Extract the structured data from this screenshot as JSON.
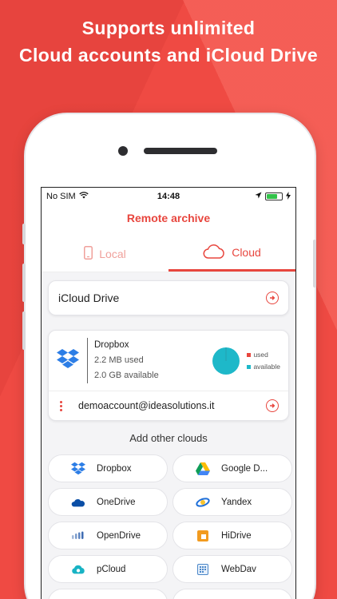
{
  "promo": {
    "line1": "Supports unlimited",
    "line2": "Cloud accounts and iCloud Drive"
  },
  "status_bar": {
    "carrier": "No SIM",
    "time": "14:48",
    "battery_color": "#33c34a"
  },
  "nav": {
    "title": "Remote archive"
  },
  "tabs": [
    {
      "label": "Local",
      "icon": "phone-icon",
      "active": false
    },
    {
      "label": "Cloud",
      "icon": "cloud-icon",
      "active": true
    }
  ],
  "icloud": {
    "label": "iCloud Drive"
  },
  "dropbox": {
    "name": "Dropbox",
    "used": "2.2 MB used",
    "available": "2.0 GB available",
    "used_fraction": 0.001,
    "legend_used": "used",
    "legend_available": "available",
    "used_color": "#e8463e",
    "available_color": "#1eb8c9",
    "account": "demoaccount@ideasolutions.it"
  },
  "add_other": {
    "title": "Add other clouds",
    "services": [
      {
        "label": "Dropbox",
        "icon": "dropbox-icon"
      },
      {
        "label": "Google D...",
        "icon": "google-drive-icon"
      },
      {
        "label": "OneDrive",
        "icon": "onedrive-icon"
      },
      {
        "label": "Yandex",
        "icon": "yandex-icon"
      },
      {
        "label": "OpenDrive",
        "icon": "opendrive-icon"
      },
      {
        "label": "HiDrive",
        "icon": "hidrive-icon"
      },
      {
        "label": "pCloud",
        "icon": "pcloud-icon"
      },
      {
        "label": "WebDav",
        "icon": "webdav-icon"
      }
    ]
  },
  "accent_color": "#e8463e"
}
